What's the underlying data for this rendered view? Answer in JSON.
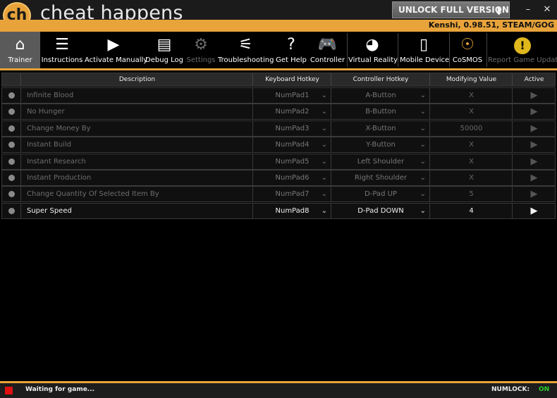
{
  "app": {
    "logo_text": "ch",
    "brand": "cheat happens",
    "unlock_label": "UNLOCK FULL VERSION",
    "game_title": "Kenshi, 0.98.51, STEAM/GOG"
  },
  "window": {
    "minimize": "–",
    "close": "✕"
  },
  "toolbar": [
    {
      "label": "Trainer",
      "icon": "home-icon",
      "glyph": "⌂"
    },
    {
      "label": "Instructions",
      "icon": "document-icon",
      "glyph": "☰"
    },
    {
      "label": "Activate Manually",
      "icon": "play-icon",
      "glyph": "▶"
    },
    {
      "label": "Debug Log",
      "icon": "notebook-icon",
      "glyph": "▤"
    },
    {
      "label": "Settings",
      "icon": "gear-icon",
      "glyph": "⚙"
    },
    {
      "label": "Troubleshooting",
      "icon": "list-icon",
      "glyph": "⚟"
    },
    {
      "label": "Get Help",
      "icon": "help-icon",
      "glyph": "?"
    },
    {
      "label": "Controller",
      "icon": "gamepad-icon",
      "glyph": "🎮"
    },
    {
      "label": "Virtual Reality",
      "icon": "vr-headset-icon",
      "glyph": "◕"
    },
    {
      "label": "Mobile Device",
      "icon": "mobile-icon",
      "glyph": "▯"
    },
    {
      "label": "CoSMOS",
      "icon": "cosmos-icon",
      "glyph": "☉"
    },
    {
      "label": "Report Game Update",
      "icon": "warning-icon",
      "glyph": "!"
    }
  ],
  "table": {
    "headers": [
      "",
      "Description",
      "Keyboard Hotkey",
      "Controller Hotkey",
      "Modifying Value",
      "Active"
    ],
    "rows": [
      {
        "description": "Infinite Blood",
        "keyboard": "NumPad1",
        "controller": "A-Button",
        "value": "X"
      },
      {
        "description": "No Hunger",
        "keyboard": "NumPad2",
        "controller": "B-Button",
        "value": "X"
      },
      {
        "description": "Change Money By",
        "keyboard": "NumPad3",
        "controller": "X-Button",
        "value": "50000"
      },
      {
        "description": "Instant Build",
        "keyboard": "NumPad4",
        "controller": "Y-Button",
        "value": "X"
      },
      {
        "description": "Instant Research",
        "keyboard": "NumPad5",
        "controller": "Left Shoulder",
        "value": "X"
      },
      {
        "description": "Instant Production",
        "keyboard": "NumPad6",
        "controller": "Right Shoulder",
        "value": "X"
      },
      {
        "description": "Change Quantity Of Selected Item By",
        "keyboard": "NumPad7",
        "controller": "D-Pad UP",
        "value": "5"
      },
      {
        "description": "Super Speed",
        "keyboard": "NumPad8",
        "controller": "D-Pad DOWN",
        "value": "4"
      }
    ]
  },
  "status": {
    "text": "Waiting for game...",
    "numlock_label": "NUMLOCK:",
    "numlock_value": "ON"
  },
  "colors": {
    "accent": "#e8a33a",
    "status_led": "#e01010",
    "numlock_on": "#2fcf2f"
  }
}
